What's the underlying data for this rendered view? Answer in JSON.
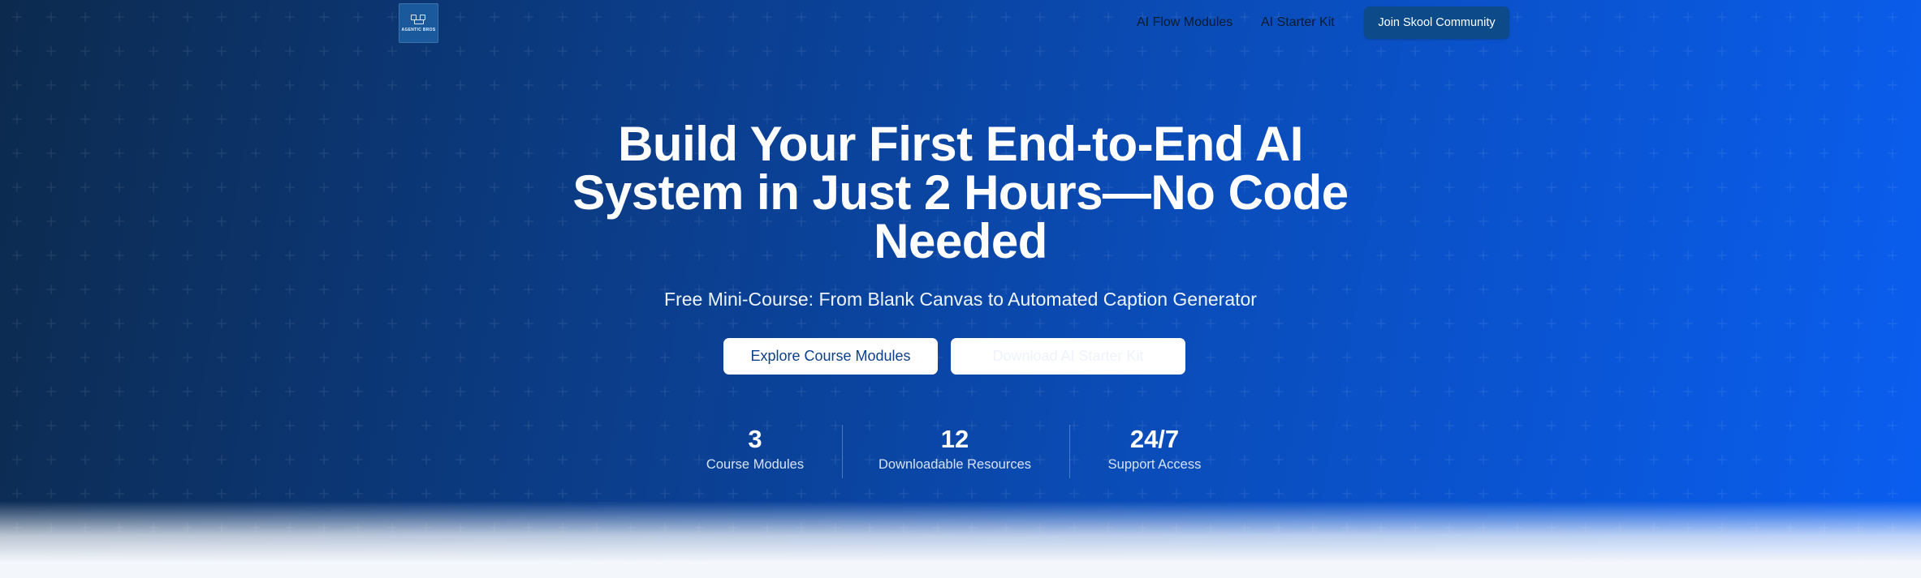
{
  "nav": {
    "logo_text": "AGENTIC BROS",
    "links": [
      "AI Flow Modules",
      "AI Starter Kit"
    ],
    "cta": "Join Skool Community"
  },
  "hero": {
    "headline": "Build Your First End-to-End AI System in Just 2 Hours—No Code Needed",
    "subtitle": "Free Mini-Course: From Blank Canvas to Automated Caption Generator",
    "primary_button": "Explore Course Modules",
    "secondary_button": "Download AI Starter Kit"
  },
  "stats": [
    {
      "value": "3",
      "label": "Course Modules"
    },
    {
      "value": "12",
      "label": "Downloadable Resources"
    },
    {
      "value": "24/7",
      "label": "Support Access"
    }
  ],
  "colors": {
    "gradient_start": "#0c2a4d",
    "gradient_end": "#0a5ef0",
    "cta_bg": "#0d4a8a",
    "primary_text": "#0c3f8a"
  }
}
